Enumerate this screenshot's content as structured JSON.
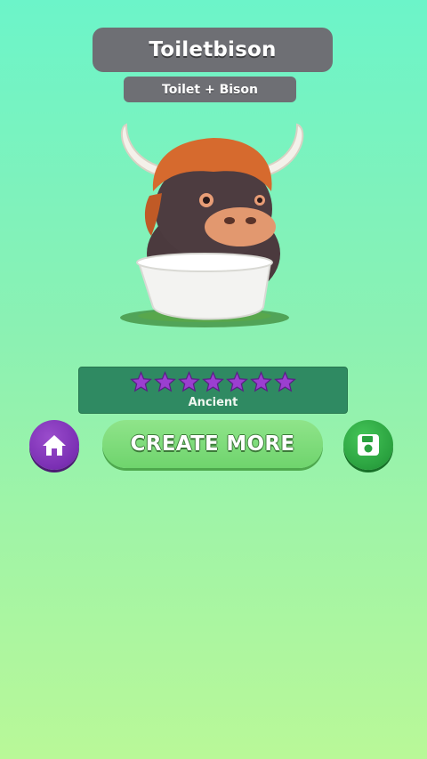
{
  "creature": {
    "name": "Toiletbison",
    "recipe": "Toilet + Bison",
    "image_label": "toilet-bison-creature"
  },
  "rarity": {
    "stars": 7,
    "label": "Ancient",
    "star_color": "#9b3fd0"
  },
  "actions": {
    "home_icon": "home-icon",
    "create_label": "CREATE MORE",
    "save_icon": "save-icon"
  },
  "colors": {
    "bg_top": "#6cf4c9",
    "bg_bottom": "#b9f898",
    "pill": "#6e6f74",
    "panel": "#2f8a62",
    "home": "#7a2fb3",
    "create": "#7bd876",
    "save": "#2aa13f"
  }
}
